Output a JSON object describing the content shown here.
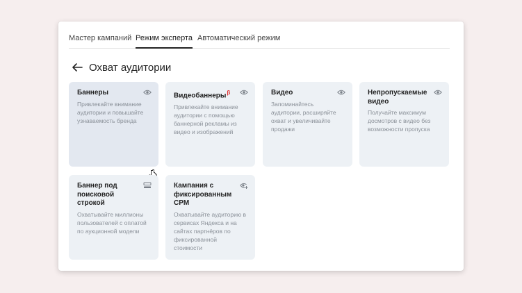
{
  "tabs": [
    {
      "label": "Мастер кампаний"
    },
    {
      "label": "Режим эксперта"
    },
    {
      "label": "Автоматический режим"
    }
  ],
  "active_tab": "Режим эксперта",
  "page_title": "Охват аудитории",
  "cards": [
    {
      "title": "Баннеры",
      "beta": "",
      "description": "Привлекайте внимание аудитории и повышайте узнаваемость бренда",
      "icon": "eye-icon"
    },
    {
      "title": "Видеобаннеры",
      "beta": "β",
      "description": "Привлекайте внимание аудитории с помощью баннерной рекламы из видео и изображений",
      "icon": "eye-icon"
    },
    {
      "title": "Видео",
      "beta": "",
      "description": "Запоминайтесь аудитории, расширяйте охват и увеличивайте продажи",
      "icon": "eye-icon"
    },
    {
      "title": "Непропускаемые видео",
      "beta": "",
      "description": "Получайте максимум досмотров с видео без возможности пропуска",
      "icon": "eye-icon"
    },
    {
      "title": "Баннер под поисковой строкой",
      "beta": "",
      "description": "Охватывайте миллионы пользователей с оплатой по аукционной модели",
      "icon": "search-banner-icon"
    },
    {
      "title": "Кампания с фиксированным CPM",
      "beta": "",
      "description": "Охватывайте аудиторию в сервисах Яндекса и на сайтах партнёров по фиксированной стоимости",
      "icon": "eye-plus-icon"
    }
  ],
  "colors": {
    "background": "#f6eeee",
    "card": "#edf1f5",
    "card_hover": "#e3e8f0",
    "beta": "#e03030"
  }
}
